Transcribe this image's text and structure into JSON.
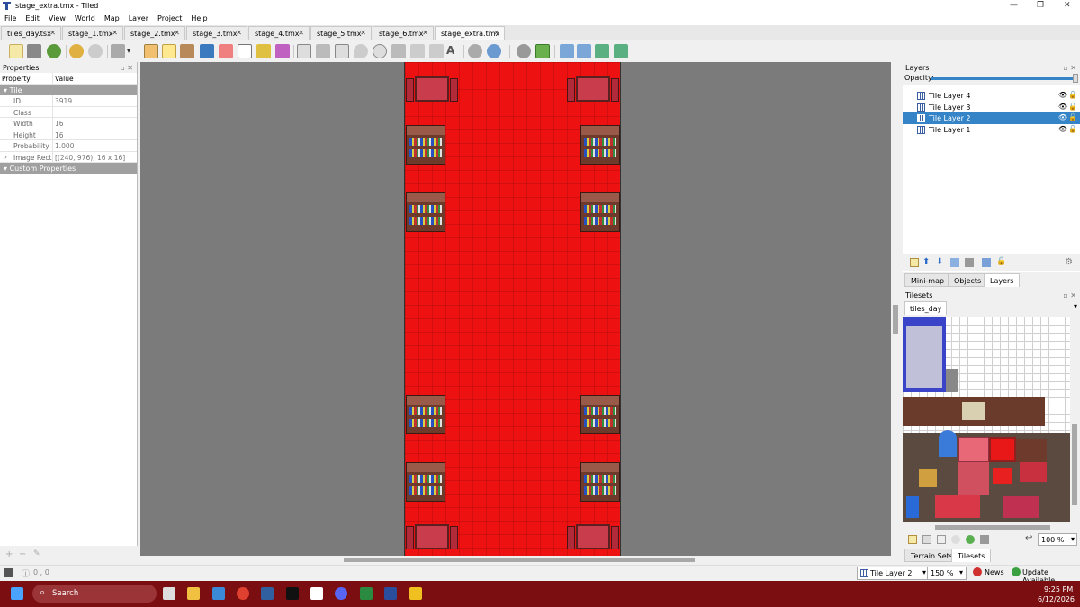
{
  "window": {
    "title": "stage_extra.tmx - Tiled"
  },
  "menu": [
    "File",
    "Edit",
    "View",
    "World",
    "Map",
    "Layer",
    "Project",
    "Help"
  ],
  "tabs": [
    {
      "label": "tiles_day.tsx"
    },
    {
      "label": "stage_1.tmx"
    },
    {
      "label": "stage_2.tmx"
    },
    {
      "label": "stage_3.tmx"
    },
    {
      "label": "stage_4.tmx"
    },
    {
      "label": "stage_5.tmx"
    },
    {
      "label": "stage_6.tmx"
    },
    {
      "label": "stage_extra.tmx"
    }
  ],
  "properties": {
    "title": "Properties",
    "col_property": "Property",
    "col_value": "Value",
    "group_tile": "Tile",
    "rows": [
      {
        "key": "ID",
        "value": "3919"
      },
      {
        "key": "Class",
        "value": ""
      },
      {
        "key": "Width",
        "value": "16"
      },
      {
        "key": "Height",
        "value": "16"
      },
      {
        "key": "Probability",
        "value": "1.000"
      },
      {
        "key": "Image Rect",
        "value": "[(240, 976), 16 x 16]"
      }
    ],
    "group_custom": "Custom Properties"
  },
  "layers": {
    "title": "Layers",
    "opacity_label": "Opacity:",
    "opacity": 1.0,
    "items": [
      {
        "name": "Tile Layer 4",
        "selected": false
      },
      {
        "name": "Tile Layer 3",
        "selected": false
      },
      {
        "name": "Tile Layer 2",
        "selected": true
      },
      {
        "name": "Tile Layer 1",
        "selected": false
      }
    ]
  },
  "right_tabs": [
    "Mini-map",
    "Objects",
    "Layers"
  ],
  "tilesets": {
    "title": "Tilesets",
    "current": "tiles_day",
    "zoom": "100 %",
    "bottom_tabs": [
      "Terrain Sets",
      "Tilesets"
    ]
  },
  "status": {
    "coords": "0 , 0",
    "layer": "Tile Layer 2",
    "zoom": "150 %",
    "news": "News",
    "update": "Update Available"
  },
  "taskbar": {
    "search": "Search",
    "time": "9:25 PM",
    "date": "6/12/2026"
  },
  "colors": {
    "accent": "#3584c8",
    "map_red": "#ee1111",
    "taskbar": "#7a0e10"
  }
}
